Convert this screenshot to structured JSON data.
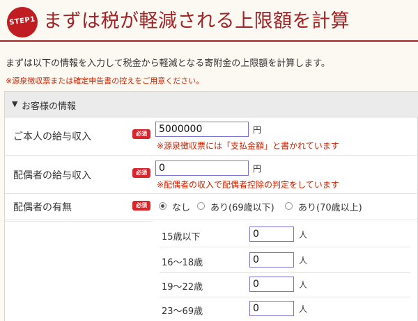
{
  "header": {
    "step_badge": "STEP1",
    "title": "まずは税が軽減される上限額を計算"
  },
  "intro": "まずは以下の情報を入力して税金から軽減となる寄附金の上限額を計算します。",
  "note": "※源泉徴収票または確定申告書の控えをご用意ください。",
  "section": {
    "toggle_icon": "▼",
    "title": "お客様の情報"
  },
  "required_badge": "必須",
  "fields": {
    "salary_self": {
      "label": "ご本人の給与収入",
      "value": "5000000",
      "unit": "円",
      "hint": "※源泉徴収票には「支払金額」と書かれています"
    },
    "salary_spouse": {
      "label": "配偶者の給与収入",
      "value": "0",
      "unit": "円",
      "hint": "※配偶者の収入で配偶者控除の判定をしています"
    },
    "spouse_exists": {
      "label": "配偶者の有無",
      "options": [
        "なし",
        "あり(69歳以下)",
        "あり(70歳以上)"
      ],
      "selected": "なし"
    }
  },
  "dependents": [
    {
      "label": "15歳以下",
      "value": "0",
      "unit": "人"
    },
    {
      "label": "16〜18歳",
      "value": "0",
      "unit": "人"
    },
    {
      "label": "19〜22歳",
      "value": "0",
      "unit": "人"
    },
    {
      "label": "23〜69歳",
      "value": "0",
      "unit": "人"
    }
  ],
  "colors": {
    "brand_red": "#a02326",
    "badge_red": "#bf1d22",
    "note_red": "#cc2200",
    "input_border": "#7b72d6"
  }
}
